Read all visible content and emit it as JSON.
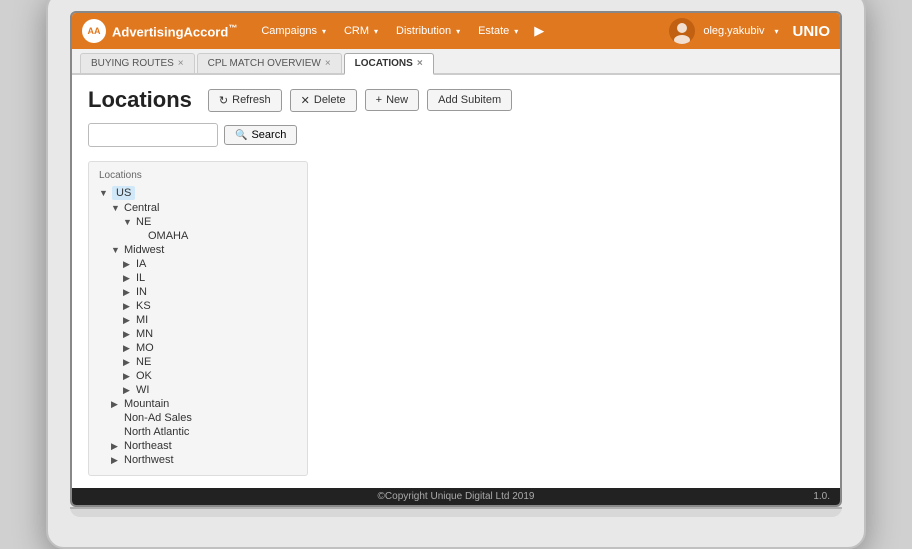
{
  "navbar": {
    "logo_text": "AA",
    "brand": "AdvertisingAccord",
    "brand_tm": "™",
    "nav_items": [
      {
        "label": "Campaigns",
        "has_dropdown": true
      },
      {
        "label": "CRM",
        "has_dropdown": true
      },
      {
        "label": "Distribution",
        "has_dropdown": true
      },
      {
        "label": "Estate",
        "has_dropdown": true
      }
    ],
    "user": "oleg.yakubiv",
    "uni_logo": "UNIO"
  },
  "tabs": [
    {
      "label": "BUYING ROUTES",
      "active": false,
      "closable": true
    },
    {
      "label": "CPL MATCH OVERVIEW",
      "active": false,
      "closable": true
    },
    {
      "label": "LOCATIONS",
      "active": true,
      "closable": true
    }
  ],
  "page": {
    "title": "Locations",
    "buttons": {
      "refresh": "Refresh",
      "delete": "Delete",
      "new": "New",
      "add_subitem": "Add Subitem",
      "search": "Search"
    },
    "search_placeholder": ""
  },
  "tree": {
    "section_label": "Locations",
    "nodes": [
      {
        "label": "US",
        "level": 0,
        "toggle": "▼",
        "selected": true
      },
      {
        "label": "Central",
        "level": 1,
        "toggle": "▼"
      },
      {
        "label": "NE",
        "level": 2,
        "toggle": "▼"
      },
      {
        "label": "OMAHA",
        "level": 3,
        "toggle": ""
      },
      {
        "label": "Midwest",
        "level": 1,
        "toggle": "▼"
      },
      {
        "label": "IA",
        "level": 2,
        "toggle": "▶"
      },
      {
        "label": "IL",
        "level": 2,
        "toggle": "▶"
      },
      {
        "label": "IN",
        "level": 2,
        "toggle": "▶"
      },
      {
        "label": "KS",
        "level": 2,
        "toggle": "▶"
      },
      {
        "label": "MI",
        "level": 2,
        "toggle": "▶"
      },
      {
        "label": "MN",
        "level": 2,
        "toggle": "▶"
      },
      {
        "label": "MO",
        "level": 2,
        "toggle": "▶"
      },
      {
        "label": "NE",
        "level": 2,
        "toggle": "▶"
      },
      {
        "label": "OK",
        "level": 2,
        "toggle": "▶"
      },
      {
        "label": "WI",
        "level": 2,
        "toggle": "▶"
      },
      {
        "label": "Mountain",
        "level": 1,
        "toggle": "▶"
      },
      {
        "label": "Non-Ad Sales",
        "level": 1,
        "toggle": ""
      },
      {
        "label": "North Atlantic",
        "level": 1,
        "toggle": ""
      },
      {
        "label": "Northeast",
        "level": 1,
        "toggle": "▶"
      },
      {
        "label": "Northwest",
        "level": 1,
        "toggle": "▶"
      }
    ]
  },
  "footer": {
    "copyright": "©Copyright Unique Digital Ltd 2019",
    "version": "1.0."
  },
  "colors": {
    "orange": "#e07820",
    "selected_bg": "#cce5f5"
  }
}
